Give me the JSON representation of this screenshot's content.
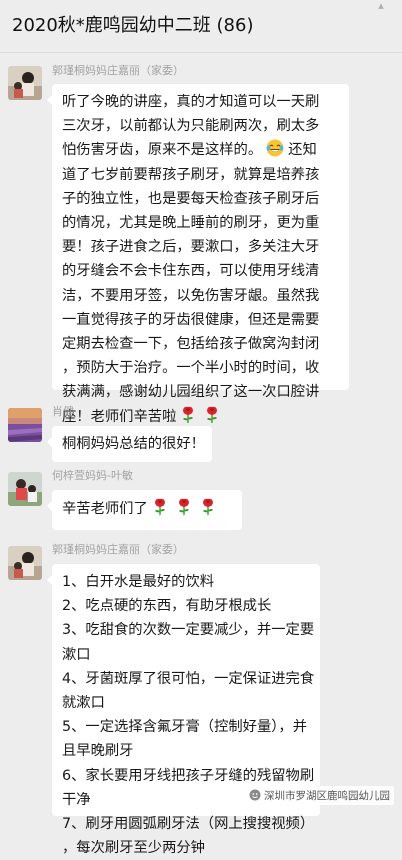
{
  "header": {
    "title": "2020秋*鹿鸣园幼中二班 (86)",
    "corner_icon": "pin-icon"
  },
  "messages": [
    {
      "sender": "郭瑾桐妈妈庄嘉丽（家委）",
      "lines": [
        "听了今晚的讲座，真的才知道可以一天刷",
        "三次牙，以前都认为只能刷两次，刷太多",
        "怕伤害牙齿，原来不是这样的。",
        "还知",
        "道了七岁前要帮孩子刷牙，就算是培养孩",
        "子的独立性，也是要每天检查孩子刷牙后",
        "的情况，尤其是晚上睡前的刷牙，更为重",
        "要！孩子进食之后，要漱口，多关注大牙",
        "的牙缝会不会卡住东西，可以使用牙线清",
        "洁，不要用牙签，以免伤害牙龈。虽然我",
        "一直觉得孩子的牙齿很健康，但还是需要",
        "定期去检查一下，包括给孩子做窝沟封闭",
        "，预防大于治疗。一个半小时的时间，收",
        "获满满，感谢幼儿园组织了这一次口腔讲",
        "座！老师们辛苦啦"
      ],
      "emoji_inline": "laughing-emoji",
      "emoji_end": [
        "rose-emoji",
        "rose-emoji"
      ]
    },
    {
      "sender": "肖健",
      "lines": [
        "桐桐妈妈总结的很好！"
      ]
    },
    {
      "sender": "何梓萱妈妈-叶敏",
      "lines": [
        "辛苦老师们了"
      ],
      "emoji_end": [
        "rose-emoji",
        "rose-emoji",
        "rose-emoji"
      ]
    },
    {
      "sender": "郭瑾桐妈妈庄嘉丽（家委）",
      "lines": [
        "1、白开水是最好的饮料",
        "2、吃点硬的东西，有助牙根成长",
        "3、吃甜食的次数一定要减少，并一定要",
        "漱口",
        "4、牙菌斑厚了很可怕，一定保证进完食",
        "就漱口",
        "5、一定选择含氟牙膏（控制好量），并",
        "且早晚刷牙",
        "6、家长要用牙线把孩子牙缝的残留物刷",
        "干净",
        "7、刷牙用圆弧刷牙法（网上搜搜视频）",
        "，每次刷牙至少两分钟"
      ]
    }
  ],
  "watermark": {
    "text": "深圳市罗湖区鹿鸣园幼儿园",
    "icon": "wechat-channel-icon"
  }
}
